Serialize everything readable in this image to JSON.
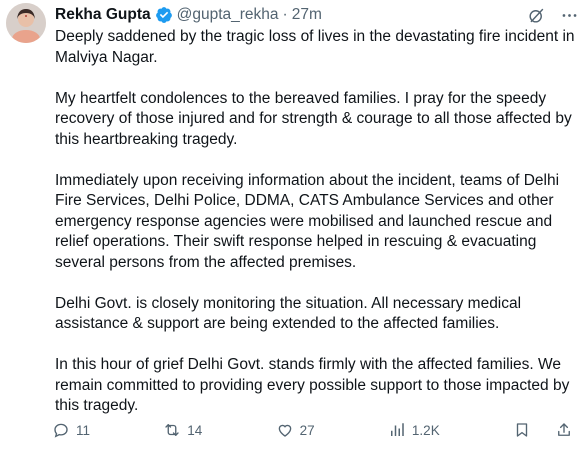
{
  "tweet": {
    "author_name": "Rekha Gupta",
    "handle": "@gupta_rekha",
    "separator": "·",
    "time": "27m",
    "paragraphs": [
      "Deeply saddened by the tragic loss of lives in the devastating fire incident in Malviya Nagar.",
      "My heartfelt condolences to the bereaved families. I pray for the speedy recovery of those injured and for strength & courage to all those affected by this heartbreaking tragedy.",
      "Immediately upon receiving information about the incident, teams of Delhi Fire Services, Delhi Police, DDMA, CATS Ambulance Services and other emergency response agencies were mobilised and launched rescue and relief operations. Their swift response helped in rescuing & evacuating several persons from the affected premises.",
      "Delhi Govt. is closely monitoring the situation. All necessary medical assistance & support are being extended to the affected families.",
      "In this hour of grief Delhi Govt. stands firmly with the affected families. We remain committed to providing every possible support to those impacted by this tragedy."
    ],
    "actions": {
      "replies": "11",
      "reposts": "14",
      "likes": "27",
      "views": "1.2K"
    }
  },
  "icons": {
    "verified": "verified-badge-icon",
    "grok": "grok-icon",
    "more": "more-icon",
    "reply": "reply-icon",
    "repost": "repost-icon",
    "like": "like-icon",
    "views": "views-icon",
    "bookmark": "bookmark-icon",
    "share": "share-icon"
  },
  "colors": {
    "text": "#0f1419",
    "secondary": "#536471",
    "verified_blue": "#1d9bf0"
  }
}
